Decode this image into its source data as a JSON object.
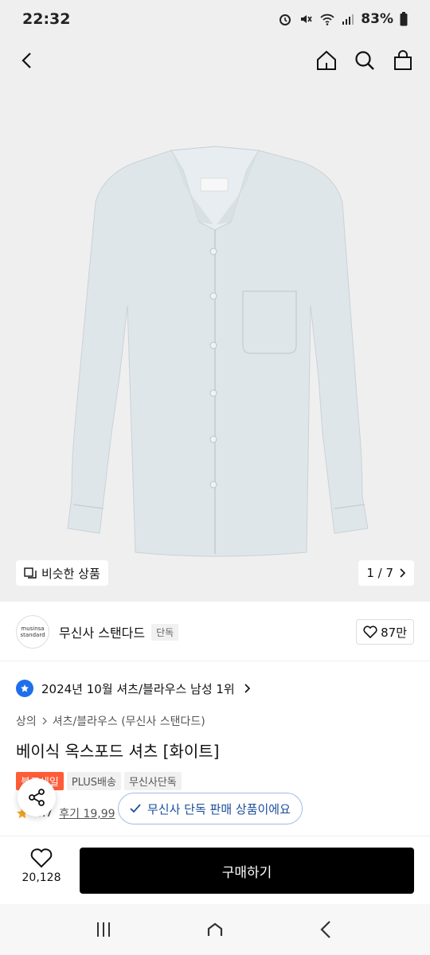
{
  "status_bar": {
    "time": "22:32",
    "battery": "83%"
  },
  "hero": {
    "similar_label": "비슷한 상품",
    "page_counter": "1 / 7",
    "shirt_color": "#dfe6ea"
  },
  "brand": {
    "logo_text_1": "musinsa",
    "logo_text_2": "standard",
    "name": "무신사 스탠다드",
    "badge": "단독",
    "likes": "87만"
  },
  "ranking": {
    "text": "2024년 10월 셔츠/블라우스 남성 1위"
  },
  "breadcrumb": {
    "level1": "상의",
    "level2": "셔츠/블라우스 (무신사 스탠다드)"
  },
  "product": {
    "title": "베이식 옥스포드 셔츠 [화이트]"
  },
  "tags": {
    "sale": "블프세일",
    "plus": "PLUS배송",
    "exclusive": "무신사단독"
  },
  "review": {
    "rating": "4.7",
    "link": "후기 19,99"
  },
  "toast": {
    "text": "무신사 단독 판매 상품이에요"
  },
  "bottom": {
    "wish_count": "20,128",
    "buy_label": "구매하기"
  },
  "colors": {
    "buy_bg": "#000000",
    "sale_tag": "#ff5c38",
    "rank_blue": "#1f6feb",
    "star": "#f5a623"
  }
}
